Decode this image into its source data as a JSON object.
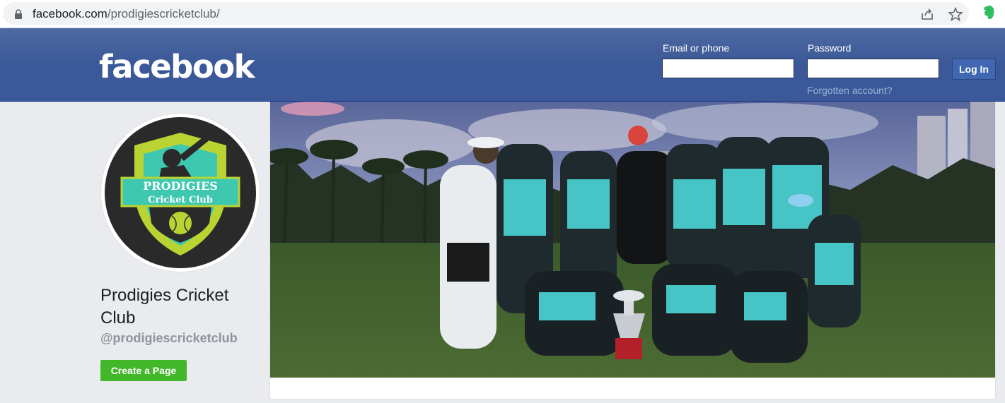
{
  "browser": {
    "url_domain": "facebook.com",
    "url_path": "/prodigiescricketclub/",
    "icons": [
      "lock-icon",
      "share-icon",
      "star-icon",
      "evernote-icon"
    ]
  },
  "header": {
    "logo": "facebook",
    "email_label": "Email or phone",
    "email_value": "",
    "password_label": "Password",
    "password_value": "",
    "login_button": "Log In",
    "forgot_link": "Forgotten account?"
  },
  "profile": {
    "logo_text_top": "PRODIGIES",
    "logo_text_bottom": "Cricket Club",
    "page_name": "Prodigies Cricket Club",
    "handle": "@prodigiescricketclub",
    "create_page_button": "Create a Page"
  },
  "colors": {
    "fb_blue": "#3b5998",
    "create_green": "#42b72a",
    "logo_teal": "#3fc8b0",
    "logo_lime": "#b9d432"
  }
}
